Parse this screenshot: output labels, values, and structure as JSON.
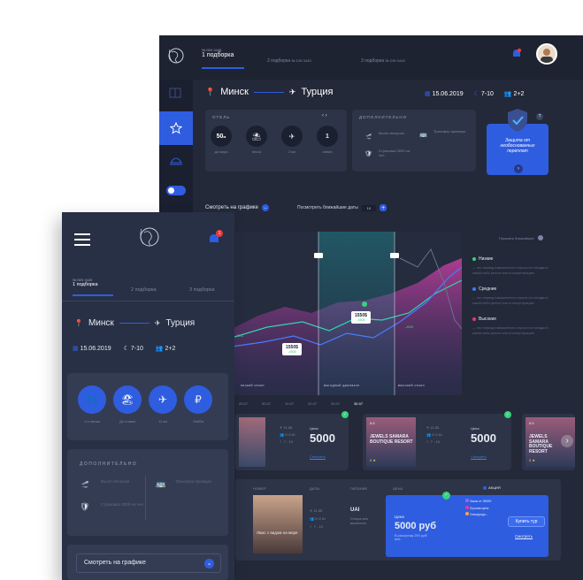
{
  "desktop": {
    "tabs": [
      {
        "tag": "№ DIN 3445",
        "label": "1 подборка",
        "active": true
      },
      {
        "label": "2 подборка",
        "tag": "№ DIN 3445"
      },
      {
        "label": "3 подборка",
        "tag": "№ DIN 3445"
      }
    ],
    "route": {
      "from": "Минск",
      "to": "Турция",
      "date": "15.06.2019",
      "nights": "7-10",
      "people": "2+2"
    },
    "hotel": {
      "title": "ОТЕЛЬ",
      "stats": [
        {
          "value": "50",
          "unit": "м",
          "label": "до моря"
        },
        {
          "value": "",
          "label": "песок"
        },
        {
          "value": "",
          "label": "2 км"
        },
        {
          "value": "1",
          "label": "линия"
        }
      ]
    },
    "extra": {
      "title": "ДОПОЛНИТЕЛЬНО",
      "items": [
        "Вылет вечером",
        "Трансфер премиум",
        "Страховка 3000 на чел"
      ]
    },
    "guarantee": {
      "text": "Защита от необоснованных переплат",
      "question": "?"
    },
    "chart_controls": {
      "label": "Смотреть на графике",
      "nearest": "Посмотреть ближайшие даты",
      "count": "10",
      "plus": "+"
    },
    "chart": {
      "show_nearest": "Показать ближайшие",
      "bands": [
        "низкий сезон",
        "выгодный диапазон",
        "высокий сезон"
      ],
      "callouts": [
        {
          "price": "1550$",
          "sub": "-450$"
        },
        {
          "price": "1550$",
          "sub": "-450$"
        },
        {
          "price": "",
          "sub": "-450$"
        },
        {
          "price": "",
          "sub": "-450$"
        }
      ],
      "dates": [
        "20.07",
        "30.07",
        "10.07",
        "20.07",
        "20.07",
        "30.07"
      ]
    },
    "legend": [
      {
        "title": "Низкие",
        "color": "#36d37a",
        "desc": "— это период повышенного спроса на поездки в какой-либо регион или в концентрацию"
      },
      {
        "title": "Средние",
        "color": "#3f7bf2",
        "desc": "— это период повышенного спроса на поездки в какой-либо регион или в концентрацию"
      },
      {
        "title": "Высокие",
        "color": "#e63a6a",
        "desc": "— это период повышенного спроса на поездки в какой-либо регион или в концентрацию"
      }
    ],
    "offers": [
      {
        "name": "JEWELS SAMARA BOUTIQUE RESORT",
        "rating": "8.6",
        "stars": "5 ★",
        "times": "11:35",
        "people": "2+2 AI",
        "nights": "7 - 10",
        "price_label": "Цена",
        "price": "5000",
        "link": "Смотреть"
      },
      {
        "name": "JEWELS SAMARA BOUTIQUE RESORT",
        "rating": "8.6",
        "stars": "5 ★",
        "times": "11:35",
        "people": "2+2 AI",
        "nights": "7 - 10",
        "price_label": "Цена",
        "price": "5000",
        "link": "Смотреть"
      },
      {
        "name": "JEWELS SAMARA BOUTIQUE RESORT",
        "rating": "8.6",
        "stars": "5 ★"
      }
    ],
    "detail": {
      "headers": [
        "НОМЕР",
        "ДАТЫ",
        "ПИТАНИЕ",
        "ЦЕНА",
        "АКЦИЯ"
      ],
      "room": "Люкс с видом на море",
      "time": "11:35",
      "people": "2+2 AI",
      "nights": "7 - 10",
      "food": "UAI",
      "food_desc": "Ультра все включено",
      "price_label": "Цена",
      "price": "5000 руб",
      "price_note": "В рассрочку 250 руб/мес",
      "badges": [
        "Заказ от 25000",
        "Лучшая цена",
        "Спецпредл..."
      ],
      "buy": "Купить тур",
      "view": "Смотреть"
    }
  },
  "mobile": {
    "tabs": [
      {
        "tag": "№ DIN 3445",
        "label": "1 подборка"
      },
      {
        "label": "2 подборка"
      },
      {
        "label": "3 подборка"
      }
    ],
    "notif_count": "1",
    "route": {
      "from": "Минск",
      "to": "Турция",
      "date": "15.06.2019",
      "nights": "7-10",
      "people": "2+2"
    },
    "features": [
      "1-я линия",
      "До пляжа",
      "11 км",
      "Лобби"
    ],
    "extra_title": "ДОПОЛНИТЕЛЬНО",
    "extra": [
      "Вылет вечером",
      "Трансфер премиум",
      "Страховка 3000 на чел"
    ],
    "chart_btn": "Смотреть на графике"
  }
}
